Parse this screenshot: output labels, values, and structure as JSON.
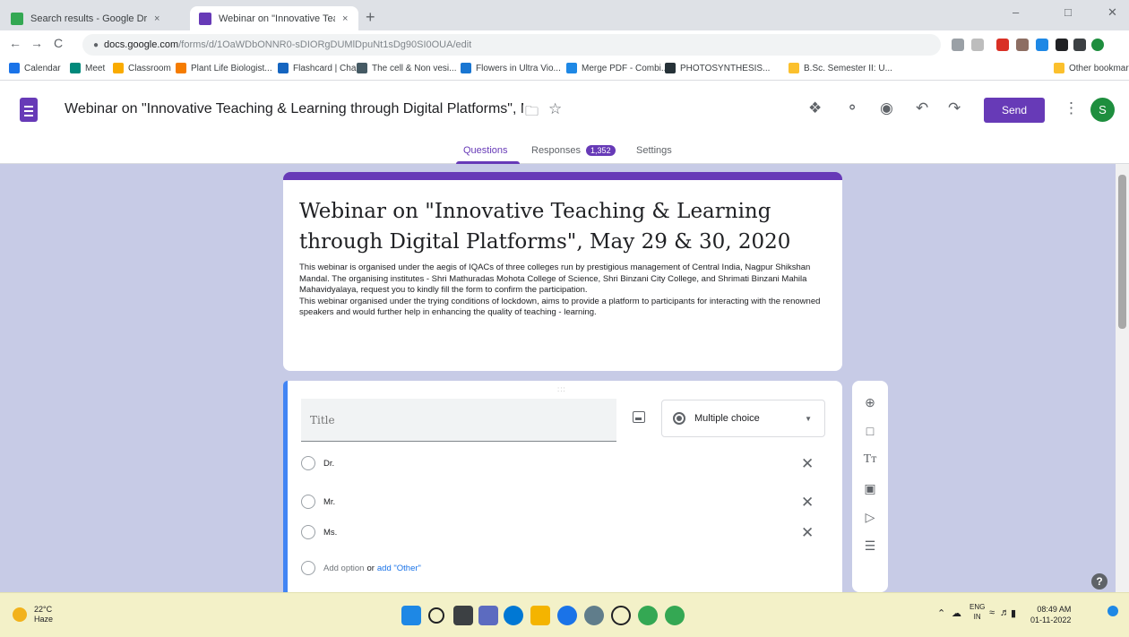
{
  "browser": {
    "tabs": [
      {
        "title": "Search results - Google Drive",
        "close": "×"
      },
      {
        "title": "Webinar on \"Innovative Teachin",
        "close": "×"
      }
    ],
    "newtab": "+",
    "window_controls": {
      "minimize": "–",
      "restore": "□",
      "close": "✕"
    },
    "nav": {
      "back": "←",
      "forward": "→",
      "reload": "C"
    },
    "url_host": "docs.google.com",
    "url_path": "/forms/d/1OaWDbONNR0-sDIORgDUMlDpuNt1sDg90SI0OUA/edit",
    "bookmarks": [
      {
        "label": "Calendar",
        "color": "#1a73e8"
      },
      {
        "label": "Meet",
        "color": "#00897b"
      },
      {
        "label": "Classroom",
        "color": "#f9ab00"
      },
      {
        "label": "Plant Life Biologist...",
        "color": "#f57c00"
      },
      {
        "label": "Flashcard | Chalk",
        "color": "#1565c0"
      },
      {
        "label": "The cell & Non vesi...",
        "color": "#455a64"
      },
      {
        "label": "Flowers in Ultra Vio...",
        "color": "#1976d2"
      },
      {
        "label": "Merge PDF - Combi...",
        "color": "#1e88e5"
      },
      {
        "label": "PHOTOSYNTHESIS...",
        "color": "#263238"
      },
      {
        "label": "B.Sc. Semester II: U...",
        "color": "#fbc02d"
      },
      {
        "label": "Other bookmarks",
        "color": "#fbc02d"
      }
    ]
  },
  "forms": {
    "doc_title": "Webinar on \"Innovative Teaching & Learning through Digital Platforms\", M",
    "send_label": "Send",
    "avatar_initial": "S",
    "tabs": {
      "questions": "Questions",
      "responses": "Responses",
      "responses_count": "1,352",
      "settings": "Settings"
    },
    "accent_color": "#673ab7"
  },
  "form": {
    "title": "Webinar on \"Innovative Teaching & Learning through Digital Platforms\", May 29 & 30, 2020",
    "description_p1": "This webinar is organised under the aegis of IQACs of three colleges run by prestigious management of Central India, Nagpur Shikshan Mandal. The organising institutes - Shri Mathuradas Mohota College of Science, Shri Binzani City College, and Shrimati Binzani Mahila Mahavidyalaya, request you to kindly fill the form to confirm the participation.",
    "description_p2": "This webinar organised under the trying conditions of lockdown, aims to provide a platform to participants for interacting with the renowned speakers and would further help in enhancing the quality of teaching - learning."
  },
  "question": {
    "title_placeholder": "Title",
    "type": "Multiple choice",
    "options": [
      "Dr.",
      "Mr.",
      "Ms."
    ],
    "add_option": "Add option",
    "or": "or",
    "add_other": "add \"Other\""
  },
  "taskbar": {
    "temperature": "22°C",
    "weather": "Haze",
    "lang": "ENG",
    "region": "IN",
    "time": "08:49 AM",
    "date": "01-11-2022"
  }
}
